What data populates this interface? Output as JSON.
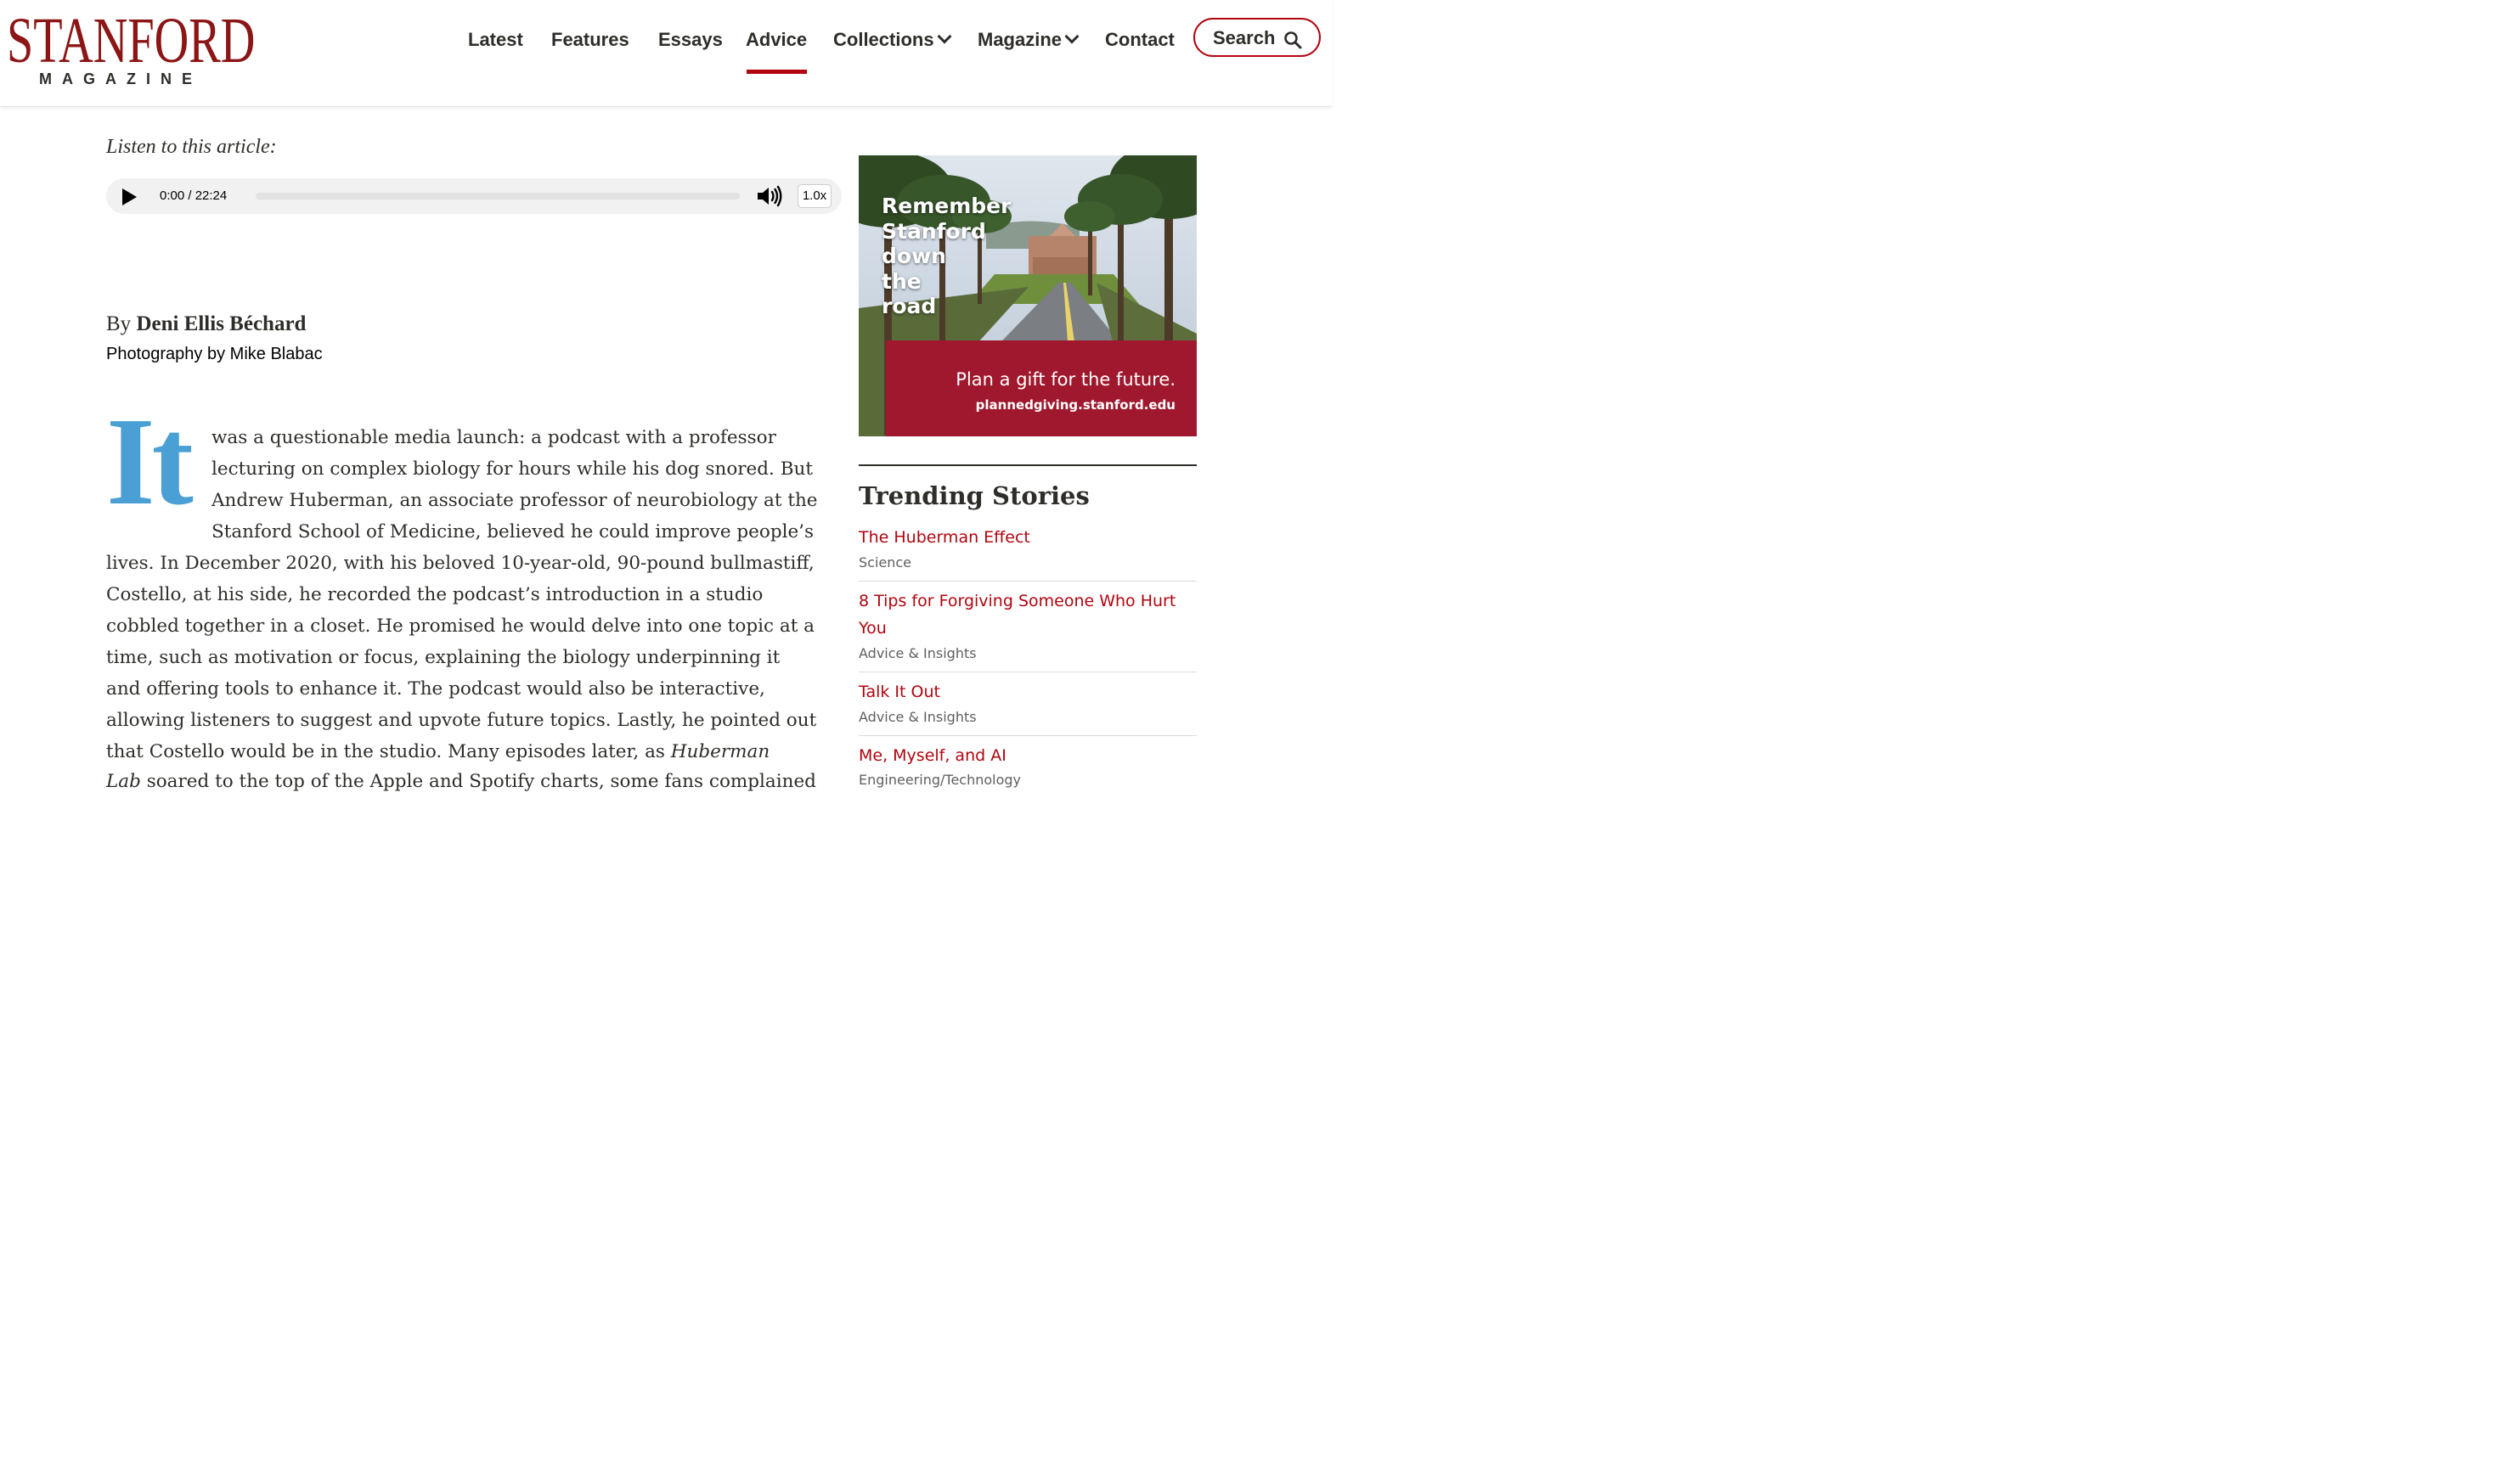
{
  "logo": {
    "main": "STANFORD",
    "sub": "MAGAZINE"
  },
  "nav": {
    "items": [
      {
        "label": "Latest"
      },
      {
        "label": "Features"
      },
      {
        "label": "Essays"
      },
      {
        "label": "Advice"
      },
      {
        "label": "Collections"
      },
      {
        "label": "Magazine"
      },
      {
        "label": "Contact"
      }
    ],
    "active": "Advice",
    "search_label": "Search"
  },
  "audio": {
    "listen_label": "Listen to this article:",
    "time": "0:00 / 22:24",
    "speed": "1.0x",
    "progress": 0
  },
  "byline": {
    "prefix": "By",
    "author": "Deni Ellis Béchard",
    "photo_credit": "Photography by Mike Blabac"
  },
  "article": {
    "dropcap": "It",
    "lines": [
      "was a questionable media launch: a podcast with a professor",
      "lecturing on complex biology for hours while his dog snored. But",
      "Andrew Huberman, an associate professor of neurobiology at the",
      "Stanford School of Medicine, believed he could improve people’s",
      "lives. In December 2020, with his beloved 10-year-old, 90-pound bullmastiff,",
      "Costello, at his side, he recorded the podcast’s introduction in a studio",
      "cobbled together in a closet. He promised he would delve into one topic at a",
      "time, such as motivation or focus, explaining the biology underpinning it",
      "and offering tools to enhance it. The podcast would also be interactive,",
      "allowing listeners to suggest and upvote future topics. Lastly, he pointed out",
      "that Costello would be in the studio. Many episodes later, as",
      "soared to the top of the Apple and Spotify charts, some fans complained"
    ],
    "italic_title_1": "Huberman",
    "italic_title_2": "Lab"
  },
  "ad": {
    "headline": [
      "Remember",
      "Stanford",
      "down",
      "the",
      "road"
    ],
    "cta": "Plan a gift for the future.",
    "url": "plannedgiving.stanford.edu"
  },
  "trending": {
    "title": "Trending Stories",
    "items": [
      {
        "title": "The Huberman Effect",
        "category": "Science"
      },
      {
        "title": "8 Tips for Forgiving Someone Who Hurt You",
        "category": "Advice & Insights"
      },
      {
        "title": "Talk It Out",
        "category": "Advice & Insights"
      },
      {
        "title": "Me, Myself, and AI",
        "category": "Engineering/Technology"
      }
    ]
  },
  "colors": {
    "brand_red": "#8c1515",
    "link_red": "#b1040e",
    "dropcap_blue": "#4a9fd4",
    "ad_band": "#a0182e"
  }
}
